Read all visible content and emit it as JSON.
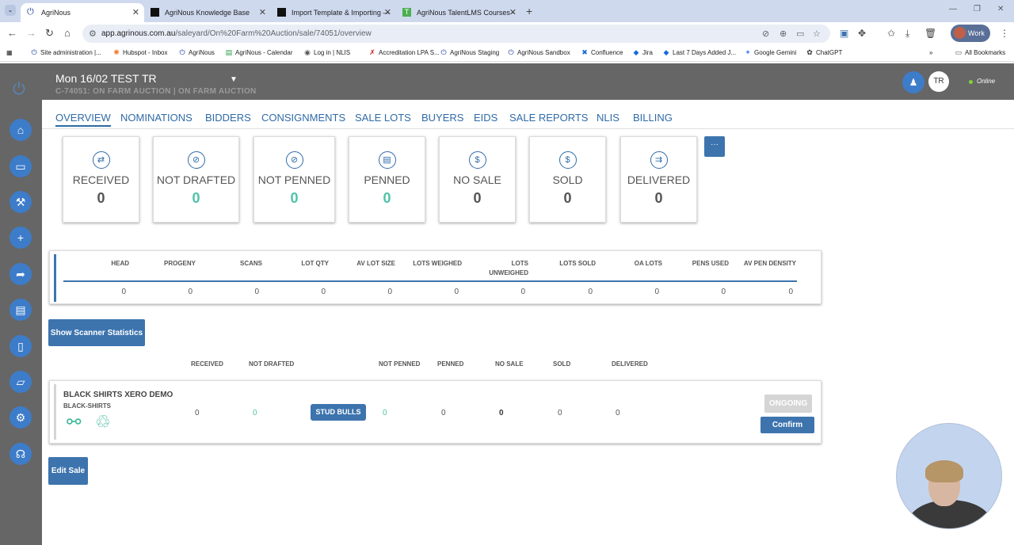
{
  "browser": {
    "tabs": [
      {
        "title": "AgriNous",
        "active": true
      },
      {
        "title": "AgriNous Knowledge Base",
        "active": false
      },
      {
        "title": "Import Template & Importing —",
        "active": false
      },
      {
        "title": "AgriNous TalentLMS Courses -",
        "active": false
      }
    ],
    "url_host": "app.agrinous.com.au",
    "url_path": "/saleyard/On%20Farm%20Auction/sale/74051/overview",
    "profile_label": "Work",
    "bookmarks": [
      "Site administration |...",
      "Hubspot - Inbox",
      "AgriNous",
      "AgriNous - Calendar",
      "Log in | NLIS",
      "Accreditation LPA S...",
      "AgriNous Staging",
      "AgriNous Sandbox",
      "Confluence",
      "Jira",
      "Last 7 Days Added J...",
      "Google Gemini",
      "ChatGPT"
    ],
    "all_bookmarks_label": "All Bookmarks"
  },
  "header": {
    "sale_title": "Mon 16/02 TEST TR",
    "sale_subtitle": "C-74051: ON FARM AUCTION | ON FARM AUCTION",
    "user_initials": "TR",
    "status": "Online"
  },
  "nav_tabs": [
    "OVERVIEW",
    "NOMINATIONS",
    "BIDDERS",
    "CONSIGNMENTS",
    "SALE LOTS",
    "BUYERS",
    "EIDS",
    "SALE REPORTS",
    "NLIS",
    "BILLING"
  ],
  "stat_cards": [
    {
      "label": "RECEIVED",
      "value": "0",
      "teal": false
    },
    {
      "label": "NOT DRAFTED",
      "value": "0",
      "teal": true
    },
    {
      "label": "NOT PENNED",
      "value": "0",
      "teal": true
    },
    {
      "label": "PENNED",
      "value": "0",
      "teal": true
    },
    {
      "label": "NO SALE",
      "value": "0",
      "teal": false
    },
    {
      "label": "SOLD",
      "value": "0",
      "teal": false
    },
    {
      "label": "DELIVERED",
      "value": "0",
      "teal": false
    }
  ],
  "more_label": "···",
  "summary": {
    "headers": [
      "HEAD",
      "PROGENY",
      "SCANS",
      "LOT QTY",
      "AV LOT SIZE",
      "LOTS WEIGHED",
      "LOTS UNWEIGHED",
      "LOTS SOLD",
      "OA LOTS",
      "PENS USED",
      "AV PEN DENSITY"
    ],
    "values": [
      "0",
      "0",
      "0",
      "0",
      "0",
      "0",
      "0",
      "0",
      "0",
      "0",
      "0"
    ]
  },
  "scanner_button": "Show Scanner Statistics",
  "consignment_headers": [
    "RECEIVED",
    "NOT DRAFTED",
    "NOT PENNED",
    "PENNED",
    "NO SALE",
    "SOLD",
    "DELIVERED"
  ],
  "consignment": {
    "name": "BLACK SHIRTS XERO DEMO",
    "code": "BLACK-SHIRTS",
    "received": "0",
    "not_drafted": "0",
    "category": "STUD BULLS",
    "not_penned": "0",
    "penned": "0",
    "no_sale": "0",
    "sold": "0",
    "delivered": "0",
    "status": "ONGOING",
    "confirm_label": "Confirm"
  },
  "edit_sale_button": "Edit Sale"
}
